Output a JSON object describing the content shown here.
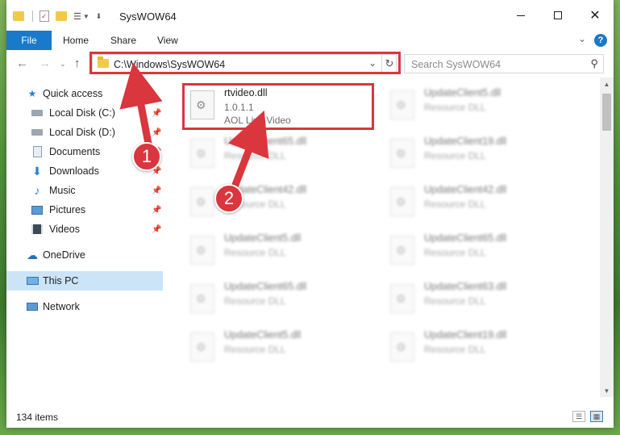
{
  "window": {
    "title": "SysWOW64"
  },
  "ribbon": {
    "file_tab": "File",
    "tabs": [
      "Home",
      "Share",
      "View"
    ],
    "help": "?"
  },
  "navigation": {
    "address": "C:\\Windows\\SysWOW64",
    "search_placeholder": "Search SysWOW64"
  },
  "sidebar": {
    "items": [
      {
        "label": "Quick access",
        "icon": "star-icon"
      },
      {
        "label": "Local Disk (C:)",
        "icon": "drive-icon",
        "pinned": true
      },
      {
        "label": "Local Disk (D:)",
        "icon": "drive-icon",
        "pinned": true
      },
      {
        "label": "Documents",
        "icon": "documents-icon",
        "pinned": true
      },
      {
        "label": "Downloads",
        "icon": "download-icon",
        "pinned": true
      },
      {
        "label": "Music",
        "icon": "music-icon",
        "pinned": true
      },
      {
        "label": "Pictures",
        "icon": "pictures-icon",
        "pinned": true
      },
      {
        "label": "Videos",
        "icon": "videos-icon",
        "pinned": true
      },
      {
        "label": "OneDrive",
        "icon": "cloud-icon"
      },
      {
        "label": "This PC",
        "icon": "computer-icon",
        "selected": true
      },
      {
        "label": "Network",
        "icon": "network-icon"
      }
    ]
  },
  "files": {
    "highlighted": {
      "name": "rtvideo.dll",
      "version": "1.0.1.1",
      "description": "AOL Live Video"
    },
    "left_column": [
      {
        "name": "UpdateClient65.dll",
        "description": "Resource DLL"
      },
      {
        "name": "UpdateClient42.dll",
        "description": "Resource DLL"
      },
      {
        "name": "UpdateClient5.dll",
        "description": "Resource DLL"
      },
      {
        "name": "UpdateClient65.dll",
        "description": "Resource DLL"
      },
      {
        "name": "UpdateClient5.dll",
        "description": "Resource DLL"
      }
    ],
    "right_column": [
      {
        "name": "UpdateClient5.dll",
        "description": "Resource DLL"
      },
      {
        "name": "UpdateClient19.dll",
        "description": "Resource DLL"
      },
      {
        "name": "UpdateClient42.dll",
        "description": "Resource DLL"
      },
      {
        "name": "UpdateClient65.dll",
        "description": "Resource DLL"
      },
      {
        "name": "UpdateClient63.dll",
        "description": "Resource DLL"
      },
      {
        "name": "UpdateClient19.dll",
        "description": "Resource DLL"
      }
    ]
  },
  "status": {
    "item_count": "134 items"
  },
  "annotations": {
    "step1": "1",
    "step2": "2",
    "color": "#d9363e"
  }
}
